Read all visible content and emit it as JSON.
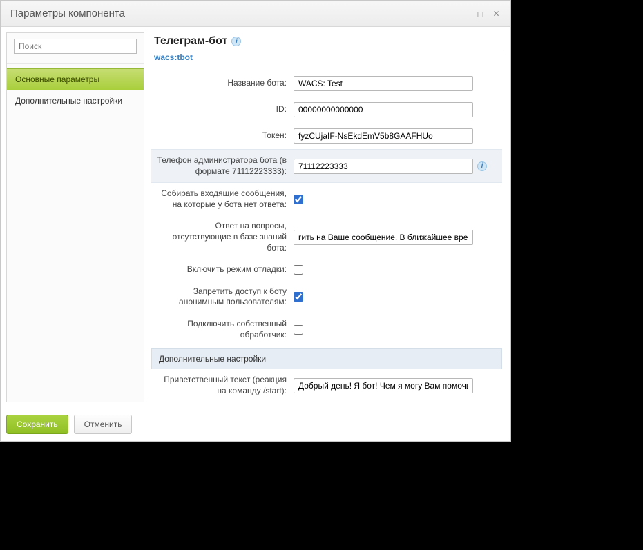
{
  "window": {
    "title": "Параметры компонента"
  },
  "sidebar": {
    "search_placeholder": "Поиск",
    "items": [
      {
        "label": "Основные параметры",
        "active": true
      },
      {
        "label": "Дополнительные настройки",
        "active": false
      }
    ]
  },
  "header": {
    "title": "Телеграм-бот",
    "code": "wacs:tbot"
  },
  "fields": {
    "bot_name": {
      "label": "Название бота:",
      "value": "WACS: Test"
    },
    "bot_id": {
      "label": "ID:",
      "value": "00000000000000"
    },
    "token": {
      "label": "Токен:",
      "value": "fyzCUjaIF-NsEkdEmV5b8GAAFHUo"
    },
    "admin_phone": {
      "label": "Телефон администратора бота (в формате 71112223333):",
      "value": "71112223333"
    },
    "collect_unanswered": {
      "label": "Собирать входящие сообщения, на которые у бота нет ответа:",
      "checked": true
    },
    "fallback_answer": {
      "label": "Ответ на вопросы, отсутствующие в базе знаний бота:",
      "value": "гить на Ваше сообщение. В ближайшее время я пол"
    },
    "debug_mode": {
      "label": "Включить режим отладки:",
      "checked": false
    },
    "deny_anonymous": {
      "label": "Запретить доступ к боту анонимным пользователям:",
      "checked": true
    },
    "custom_handler": {
      "label": "Подключить собственный обработчик:",
      "checked": false
    },
    "section_additional": "Дополнительные настройки",
    "welcome_text": {
      "label": "Приветственный текст (реакция на команду /start):",
      "value": "Добрый день! Я бот! Чем я могу Вам помочь?"
    }
  },
  "footer": {
    "save": "Сохранить",
    "cancel": "Отменить"
  }
}
